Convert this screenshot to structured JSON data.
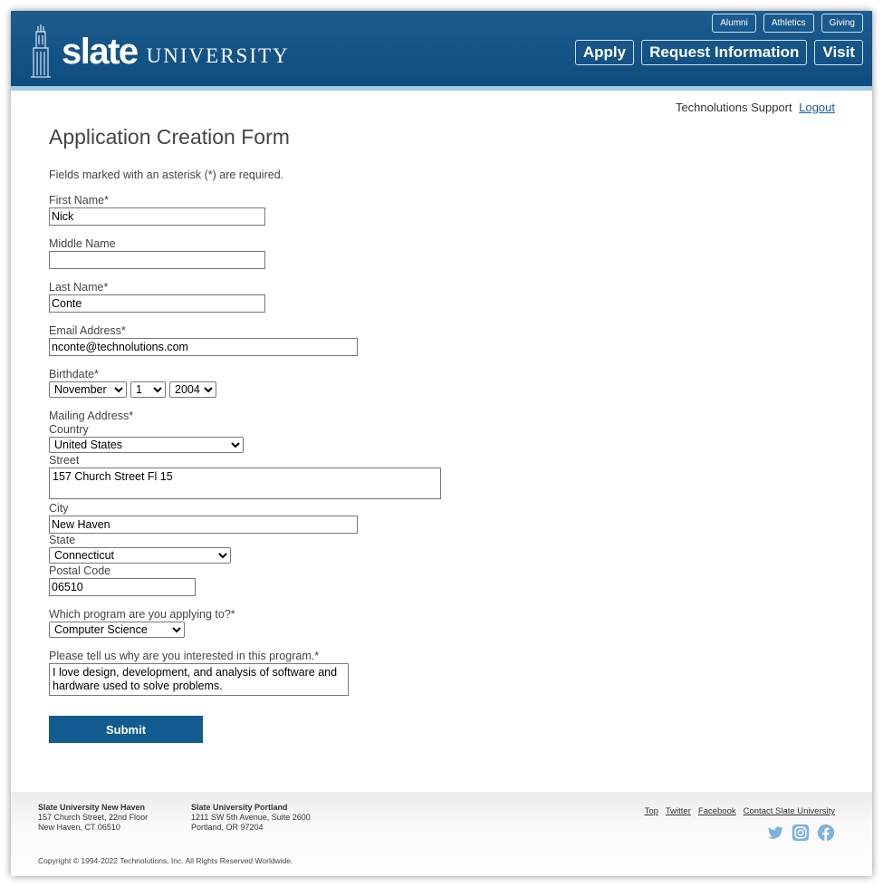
{
  "header": {
    "logo_word": "slate",
    "logo_sub": "UNIVERSITY",
    "util_nav": [
      "Alumni",
      "Athletics",
      "Giving"
    ],
    "main_nav": [
      "Apply",
      "Request Information",
      "Visit"
    ],
    "brand_color": "#0f4d7f",
    "accent_color": "#9fcbe8"
  },
  "userbar": {
    "name": "Technolutions Support",
    "logout": "Logout"
  },
  "form": {
    "title": "Application Creation Form",
    "note": "Fields marked with an asterisk (*) are required.",
    "first_name": {
      "label": "First Name*",
      "value": "Nick"
    },
    "middle_name": {
      "label": "Middle Name",
      "value": ""
    },
    "last_name": {
      "label": "Last Name*",
      "value": "Conte"
    },
    "email": {
      "label": "Email Address*",
      "value": "nconte@technolutions.com"
    },
    "birthdate": {
      "label": "Birthdate*",
      "month": "November",
      "day": "1",
      "year": "2004"
    },
    "mailing": {
      "label": "Mailing Address*",
      "country_label": "Country",
      "country": "United States",
      "street_label": "Street",
      "street": "157 Church Street Fl 15",
      "city_label": "City",
      "city": "New Haven",
      "state_label": "State",
      "state": "Connecticut",
      "postal_label": "Postal Code",
      "postal": "06510"
    },
    "program": {
      "label": "Which program are you applying to?*",
      "value": "Computer Science"
    },
    "interest": {
      "label": "Please tell us why are you interested in this program.*",
      "value": "I love design, development, and analysis of software and hardware used to solve problems."
    },
    "submit_label": "Submit"
  },
  "footer": {
    "loc1": {
      "name": "Slate University New Haven",
      "line1": "157 Church Street, 22nd Floor",
      "line2": "New Haven, CT 06510"
    },
    "loc2": {
      "name": "Slate University Portland",
      "line1": "1211 SW 5th Avenue, Suite 2600",
      "line2": "Portland, OR 97204"
    },
    "links": [
      "Top",
      "Twitter",
      "Facebook",
      "Contact Slate University"
    ],
    "social_icons": [
      "twitter-icon",
      "instagram-icon",
      "facebook-icon"
    ],
    "social_color": "#7fb2dc",
    "copyright": "Copyright © 1994-2022 Technolutions, Inc. All Rights Reserved Worldwide."
  }
}
